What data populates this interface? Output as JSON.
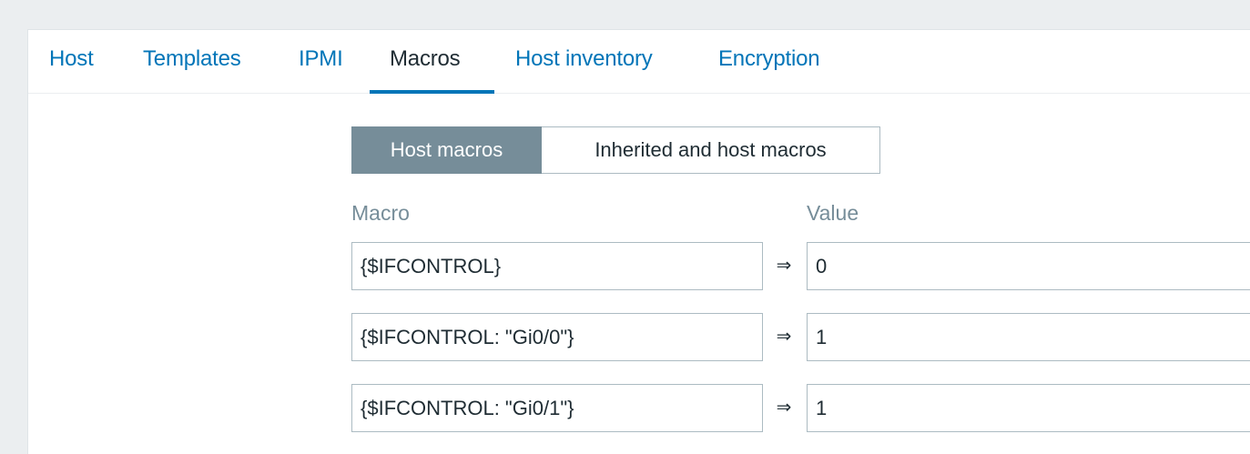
{
  "tabs": [
    {
      "label": "Host",
      "active": false
    },
    {
      "label": "Templates",
      "active": false
    },
    {
      "label": "IPMI",
      "active": false
    },
    {
      "label": "Macros",
      "active": true
    },
    {
      "label": "Host inventory",
      "active": false
    },
    {
      "label": "Encryption",
      "active": false
    }
  ],
  "macro_mode": {
    "options": [
      "Host macros",
      "Inherited and host macros"
    ],
    "selected": "Host macros"
  },
  "columns": {
    "macro": "Macro",
    "value": "Value"
  },
  "macros": [
    {
      "macro": "{$IFCONTROL}",
      "arrow": "⇒",
      "value": "0"
    },
    {
      "macro": "{$IFCONTROL: \"Gi0/0\"}",
      "arrow": "⇒",
      "value": "1"
    },
    {
      "macro": "{$IFCONTROL: \"Gi0/1\"}",
      "arrow": "⇒",
      "value": "1"
    }
  ],
  "colors": {
    "link": "#0275b8",
    "active_text": "#1f2c33",
    "segment_active_bg": "#768d99",
    "border": "#acbbc2",
    "background": "#ebeef0"
  }
}
